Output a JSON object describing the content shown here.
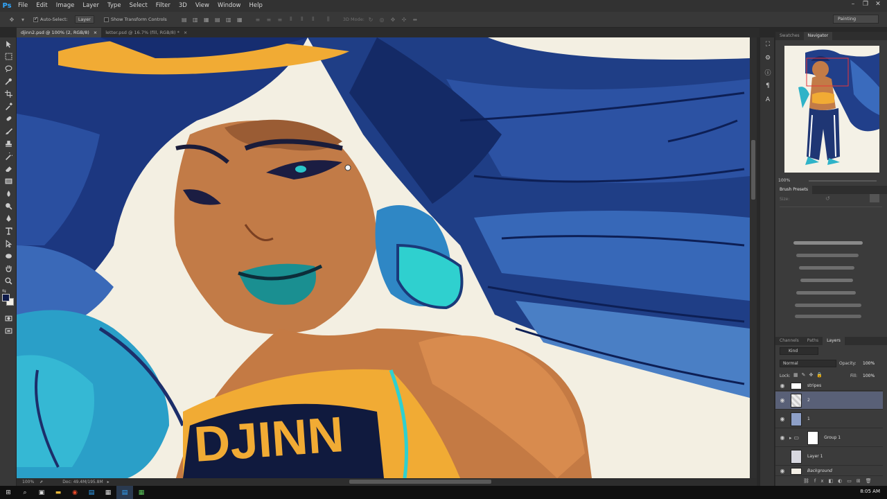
{
  "app": {
    "logo": "Ps",
    "menu": [
      "File",
      "Edit",
      "Image",
      "Layer",
      "Type",
      "Select",
      "Filter",
      "3D",
      "View",
      "Window",
      "Help"
    ],
    "window_controls": [
      "–",
      "❐",
      "✕"
    ]
  },
  "options_bar": {
    "auto_select_label": "Auto-Select:",
    "auto_select_target": "Layer",
    "transform_controls_label": "Show Transform Controls",
    "mode_3d_label": "3D Mode:",
    "workspace": "Painting"
  },
  "doc_tabs": [
    {
      "label": "djinn2.psd @ 100% (2, RGB/8)",
      "close": "×",
      "active": true
    },
    {
      "label": "letter.psd @ 16.7% (fill, RGB/8) *",
      "close": "×",
      "active": false
    }
  ],
  "status_bar": {
    "zoom": "100%",
    "doc_info": "Doc: 49.4M/195.8M"
  },
  "navigator": {
    "tabs": [
      "Swatches",
      "Navigator"
    ],
    "active_tab": "Navigator",
    "zoom": "100%"
  },
  "brush_presets": {
    "title": "Brush Presets",
    "size_label": "Size:"
  },
  "layers": {
    "tabs": [
      "Channels",
      "Paths",
      "Layers"
    ],
    "active_tab": "Layers",
    "filter": "Kind",
    "blend_mode": "Normal",
    "opacity_label": "Opacity:",
    "opacity": "100%",
    "lock_label": "Lock:",
    "fill_label": "Fill:",
    "fill": "100%",
    "items": [
      {
        "name": "stripes",
        "visible": true,
        "selected": false
      },
      {
        "name": "2",
        "visible": true,
        "selected": true
      },
      {
        "name": "1",
        "visible": true,
        "selected": false
      },
      {
        "name": "Group 1",
        "visible": true,
        "selected": false
      },
      {
        "name": "Layer 1",
        "visible": false,
        "selected": false
      },
      {
        "name": "Background",
        "visible": true,
        "selected": false
      }
    ]
  },
  "canvas_art": {
    "shirt_text": "DJINN"
  },
  "taskbar": {
    "clock": "8:05 AM"
  },
  "colors": {
    "foreground": "#0e1a4a",
    "background": "#f3efe6",
    "accent_selected_layer": "#596077"
  }
}
